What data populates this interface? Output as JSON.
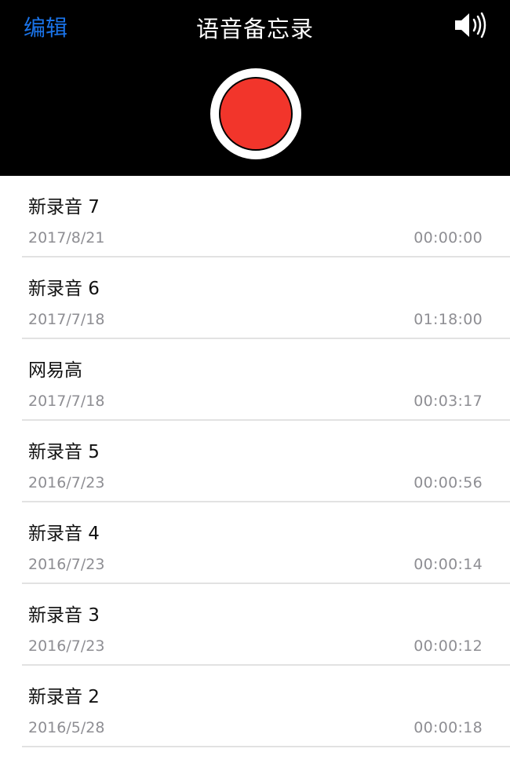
{
  "header": {
    "edit_label": "编辑",
    "title": "语音备忘录",
    "speaker_icon": "speaker-volume-icon",
    "record_icon": "record-button-icon",
    "colors": {
      "background": "#000000",
      "edit": "#1a73e8",
      "record": "#f2352b"
    }
  },
  "recordings": [
    {
      "name": "新录音 7",
      "date": "2017/8/21",
      "duration": "00:00:00"
    },
    {
      "name": "新录音 6",
      "date": "2017/7/18",
      "duration": "01:18:00"
    },
    {
      "name": "网易高",
      "date": "2017/7/18",
      "duration": "00:03:17"
    },
    {
      "name": "新录音 5",
      "date": "2016/7/23",
      "duration": "00:00:56"
    },
    {
      "name": "新录音 4",
      "date": "2016/7/23",
      "duration": "00:00:14"
    },
    {
      "name": "新录音 3",
      "date": "2016/7/23",
      "duration": "00:00:12"
    },
    {
      "name": "新录音 2",
      "date": "2016/5/28",
      "duration": "00:00:18"
    }
  ]
}
